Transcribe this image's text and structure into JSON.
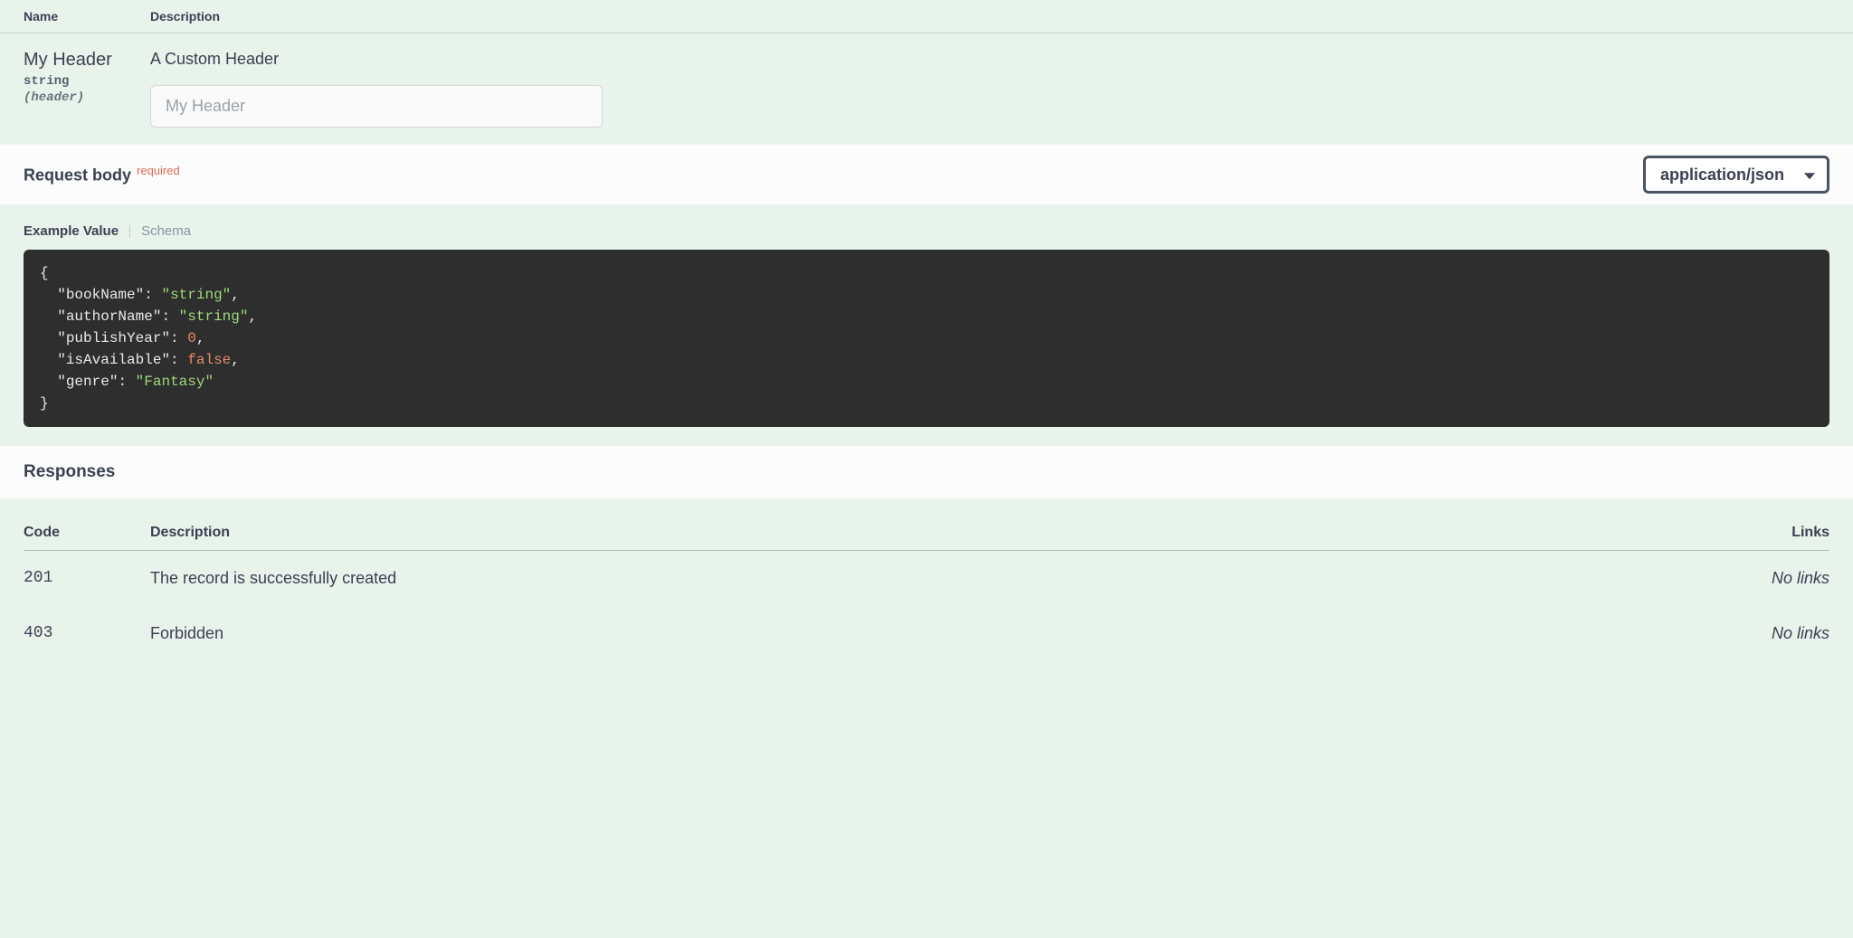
{
  "paramsHeader": {
    "nameCol": "Name",
    "descCol": "Description"
  },
  "parameter": {
    "name": "My Header",
    "type": "string",
    "in": "(header)",
    "description": "A Custom Header",
    "placeholder": "My Header"
  },
  "requestBody": {
    "label": "Request body",
    "requiredTag": "required",
    "contentType": "application/json"
  },
  "tabs": {
    "example": "Example Value",
    "schema": "Schema"
  },
  "exampleBody": {
    "keys": {
      "bookName": "bookName",
      "authorName": "authorName",
      "publishYear": "publishYear",
      "isAvailable": "isAvailable",
      "genre": "genre"
    },
    "values": {
      "bookName": "string",
      "authorName": "string",
      "publishYear": "0",
      "isAvailable": "false",
      "genre": "Fantasy"
    }
  },
  "responses": {
    "heading": "Responses",
    "columns": {
      "code": "Code",
      "description": "Description",
      "links": "Links"
    },
    "rows": [
      {
        "code": "201",
        "description": "The record is successfully created",
        "links": "No links"
      },
      {
        "code": "403",
        "description": "Forbidden",
        "links": "No links"
      }
    ]
  }
}
